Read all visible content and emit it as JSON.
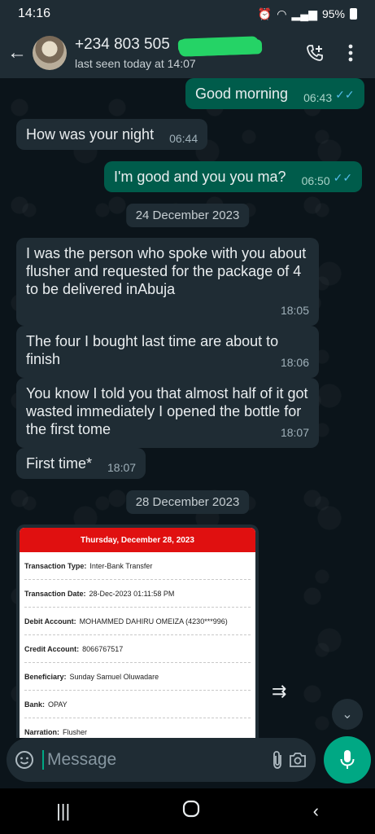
{
  "status_bar": {
    "time": "14:16",
    "battery": "95%"
  },
  "header": {
    "contact_name": "+234 803 505",
    "last_seen": "last seen today at 14:07"
  },
  "messages": [
    {
      "text": "Good morning",
      "time": "06:43"
    },
    {
      "text": "How was your night",
      "time": "06:44"
    },
    {
      "text": "I'm good and you you ma?",
      "time": "06:50"
    },
    {
      "text": "I was the person who spoke with you about flusher and requested for the package of 4 to be delivered inAbuja",
      "time": "18:05"
    },
    {
      "text": "The four I bought last time are about to finish",
      "time": "18:06"
    },
    {
      "text": "You know I told you that almost half of it got wasted immediately I opened the bottle for the first tome",
      "time": "18:07"
    },
    {
      "text": "First time*",
      "time": "18:07"
    }
  ],
  "dates": [
    "24 December 2023",
    "28 December 2023"
  ],
  "receipt": {
    "header": "Thursday, December 28, 2023",
    "rows": [
      {
        "label": "Transaction Type:",
        "value": "Inter-Bank Transfer"
      },
      {
        "label": "Transaction Date:",
        "value": "28-Dec-2023 01:11:58 PM"
      },
      {
        "label": "Debit Account:",
        "value": "MOHAMMED DAHIRU OMEIZA (4230***996)"
      },
      {
        "label": "Credit Account:",
        "value": "8066767517"
      },
      {
        "label": "Beneficiary:",
        "value": "Sunday Samuel Oluwadare"
      },
      {
        "label": "Bank:",
        "value": "OPAY"
      },
      {
        "label": "Narration:",
        "value": "Flusher"
      }
    ]
  },
  "input": {
    "placeholder": "Message"
  },
  "icons": {
    "back": "arrow-left-icon",
    "add_call": "add-call-icon",
    "menu": "more-vert-icon",
    "emoji": "emoji-icon",
    "attach": "paperclip-icon",
    "camera": "camera-icon",
    "mic": "mic-icon",
    "forward": "forward-icon",
    "scroll_down": "double-chevron-down-icon"
  },
  "colors": {
    "accent": "#00a884",
    "outgoing_bubble": "#005c4b",
    "incoming_bubble": "#1f2c34",
    "read_ticks": "#53bdeb",
    "receipt_header": "#e01010",
    "redaction": "#25d366"
  }
}
